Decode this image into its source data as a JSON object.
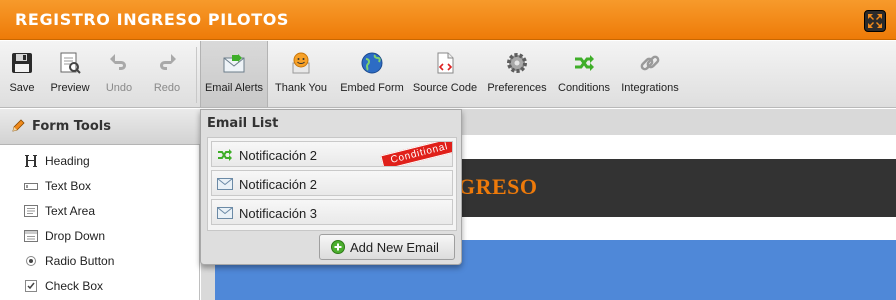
{
  "window": {
    "title": "REGISTRO INGRESO PILOTOS"
  },
  "toolbar": {
    "items": [
      {
        "label": "Save",
        "icon": "floppy-disk-icon"
      },
      {
        "label": "Preview",
        "icon": "preview-icon"
      },
      {
        "label": "Undo",
        "icon": "undo-icon"
      },
      {
        "label": "Redo",
        "icon": "redo-icon"
      },
      {
        "label": "Email Alerts",
        "icon": "email-alert-icon"
      },
      {
        "label": "Thank You",
        "icon": "smiley-icon"
      },
      {
        "label": "Embed Form",
        "icon": "globe-icon"
      },
      {
        "label": "Source Code",
        "icon": "source-code-icon"
      },
      {
        "label": "Preferences",
        "icon": "gear-icon"
      },
      {
        "label": "Conditions",
        "icon": "conditions-icon"
      },
      {
        "label": "Integrations",
        "icon": "chain-link-icon"
      }
    ]
  },
  "sidebar": {
    "title": "Form Tools",
    "items": [
      {
        "label": "Heading",
        "icon": "heading-icon"
      },
      {
        "label": "Text Box",
        "icon": "textbox-icon"
      },
      {
        "label": "Text Area",
        "icon": "textarea-icon"
      },
      {
        "label": "Drop Down",
        "icon": "dropdown-icon"
      },
      {
        "label": "Radio Button",
        "icon": "radio-icon"
      },
      {
        "label": "Check Box",
        "icon": "checkbox-icon"
      }
    ]
  },
  "email_popup": {
    "title": "Email List",
    "items": [
      {
        "label": "Notificación 2",
        "badge": "Conditional",
        "icon": "conditions-icon"
      },
      {
        "label": "Notificación 2",
        "icon": "envelope-icon"
      },
      {
        "label": "Notificación 3",
        "icon": "envelope-icon"
      }
    ],
    "add_button_label": "Add New Email"
  },
  "form_preview": {
    "header_text": "GRESO"
  },
  "colors": {
    "accent": "#ee7b08",
    "form_header": "#333333",
    "form_blue": "#4f88d8",
    "badge": "#e0201a"
  }
}
